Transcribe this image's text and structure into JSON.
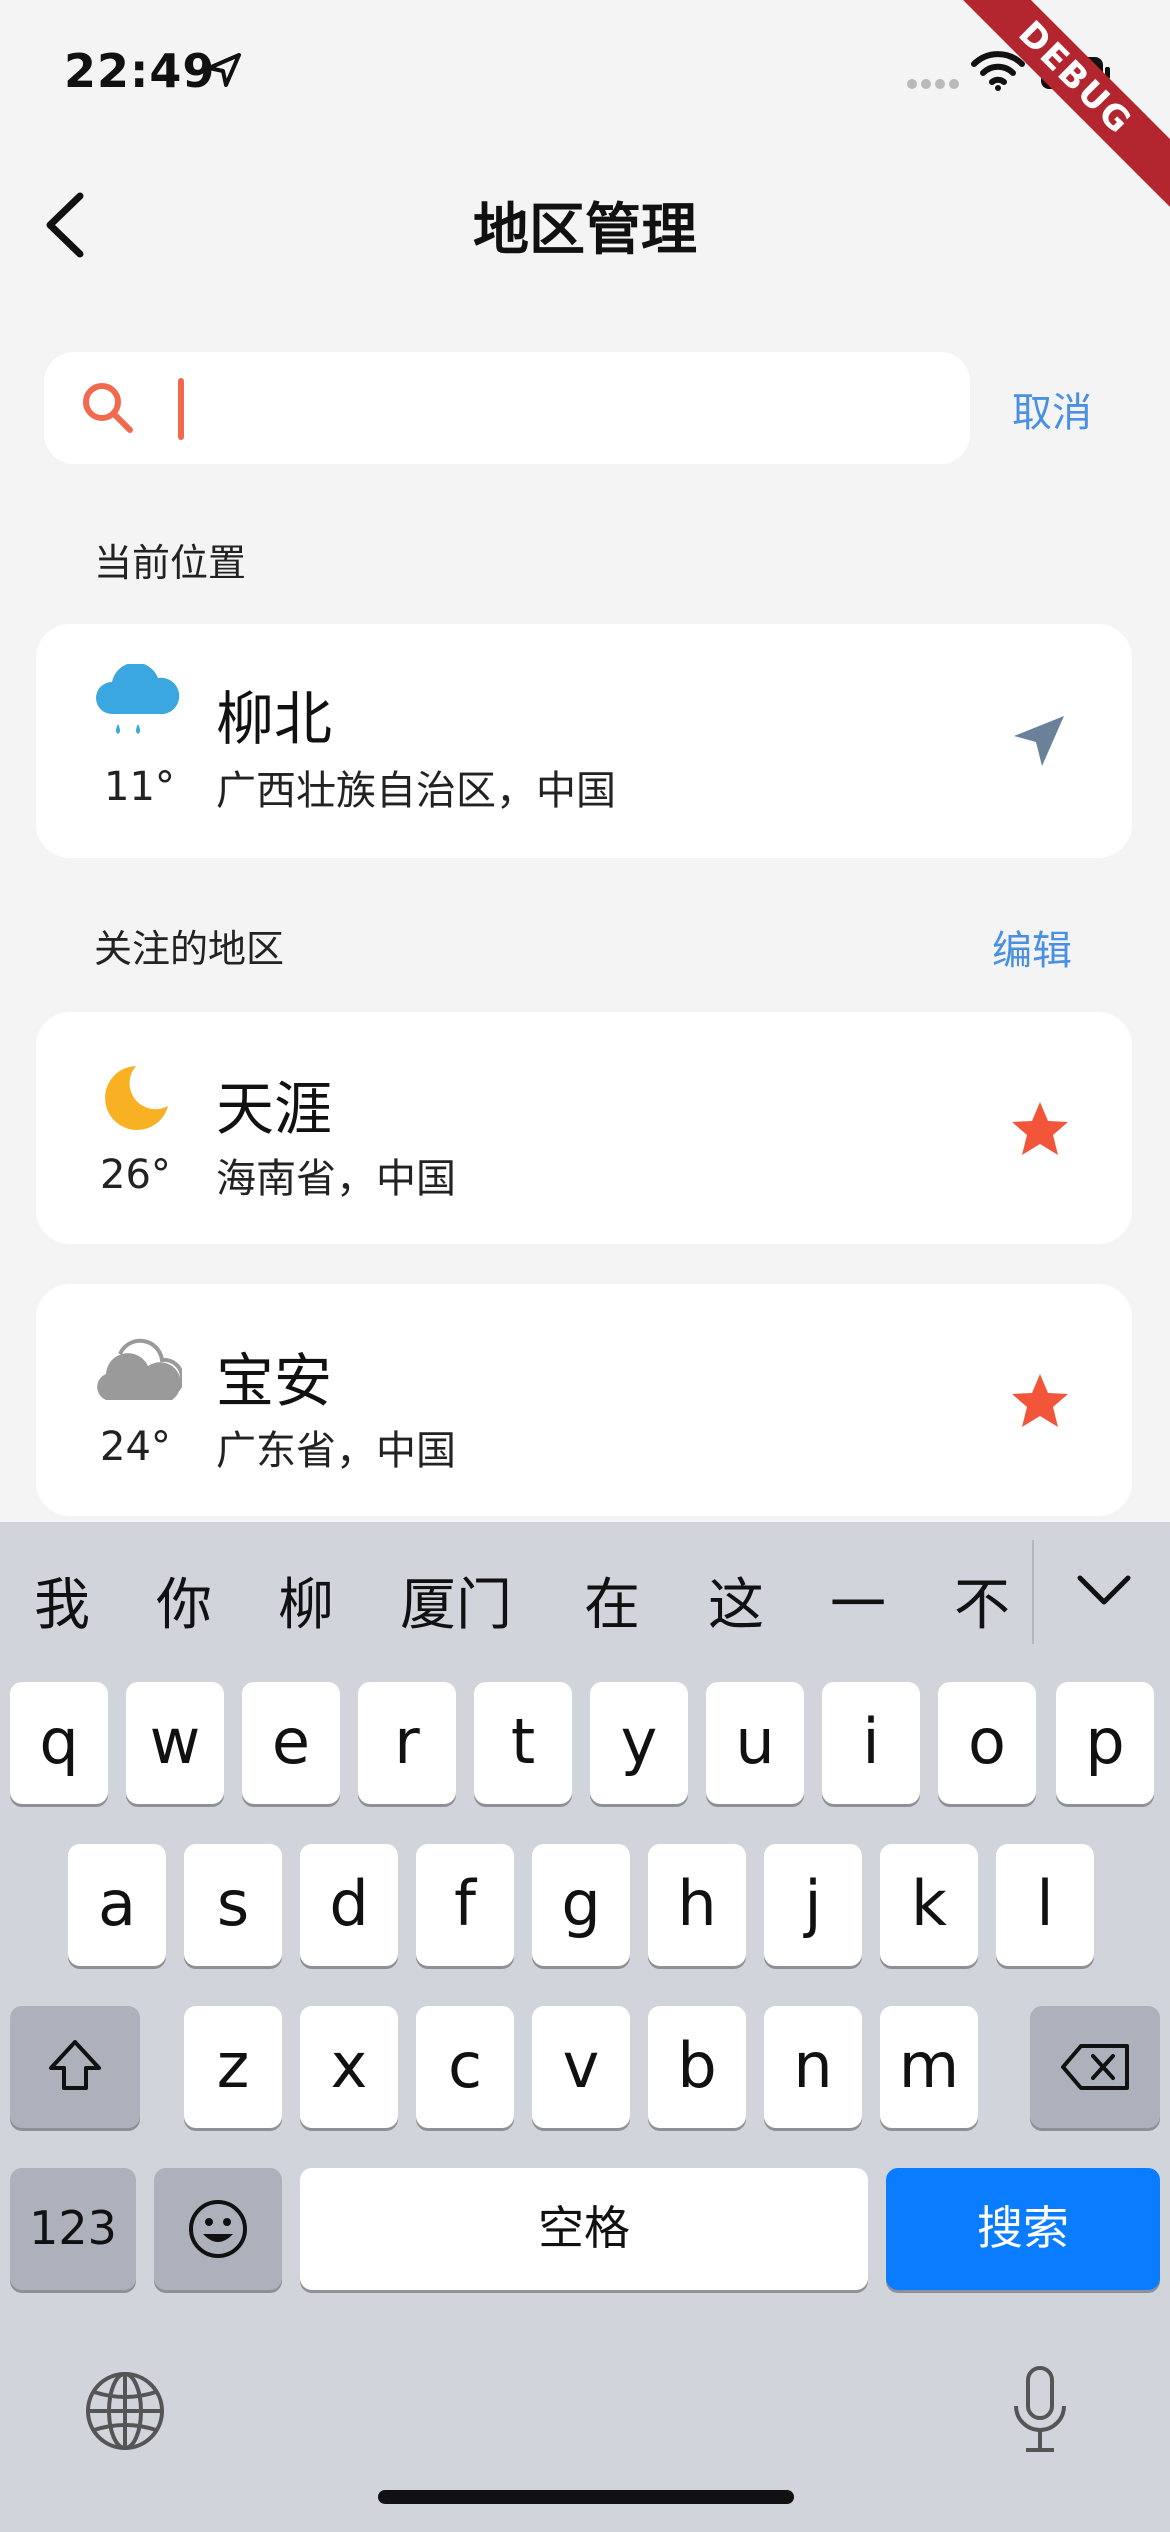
{
  "status_bar": {
    "time": "22:49",
    "debug_banner": "DEBUG"
  },
  "header": {
    "title": "地区管理"
  },
  "search": {
    "placeholder": "",
    "cancel_label": "取消"
  },
  "current_location": {
    "section_label": "当前位置",
    "city": "柳北",
    "region": "广西壮族自治区，中国",
    "temperature": "11°",
    "weather_icon": "rain-cloud-icon"
  },
  "followed": {
    "section_label": "关注的地区",
    "edit_label": "编辑",
    "items": [
      {
        "city": "天涯",
        "region": "海南省，中国",
        "temperature": "26°",
        "weather_icon": "crescent-moon-icon"
      },
      {
        "city": "宝安",
        "region": "广东省，中国",
        "temperature": "24°",
        "weather_icon": "cloud-icon"
      }
    ]
  },
  "keyboard": {
    "candidates": [
      "我",
      "你",
      "柳",
      "厦门",
      "在",
      "这",
      "一",
      "不"
    ],
    "row1": [
      "q",
      "w",
      "e",
      "r",
      "t",
      "y",
      "u",
      "i",
      "o",
      "p"
    ],
    "row2": [
      "a",
      "s",
      "d",
      "f",
      "g",
      "h",
      "j",
      "k",
      "l"
    ],
    "row3": [
      "z",
      "x",
      "c",
      "v",
      "b",
      "n",
      "m"
    ],
    "numbers_label": "123",
    "space_label": "空格",
    "search_label": "搜索"
  },
  "colors": {
    "accent_blue": "#4a90e2",
    "star": "#f2553a",
    "search_key": "#0a7cff"
  }
}
